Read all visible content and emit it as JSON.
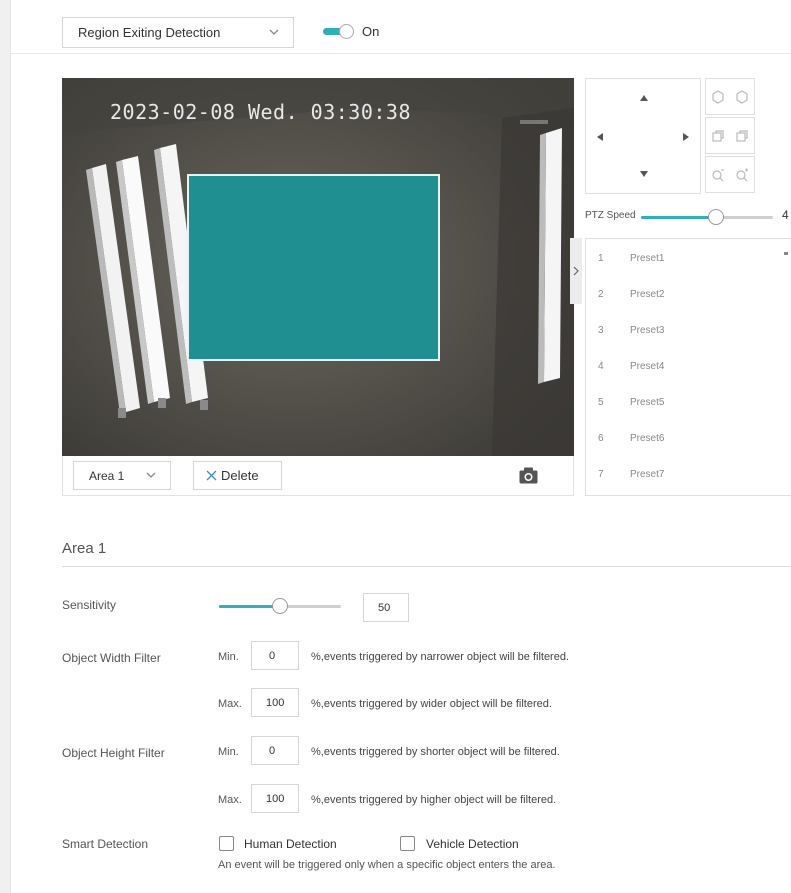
{
  "header": {
    "detection_select": "Region Exiting Detection",
    "toggle_label": "On",
    "toggle_on": true
  },
  "video": {
    "timestamp": "2023-02-08 Wed. 03:30:38"
  },
  "video_toolbar": {
    "area_select": "Area 1",
    "delete_label": "Delete"
  },
  "ptz": {
    "speed_label": "PTZ Speed",
    "speed_value": "4",
    "speed_fraction": 0.57
  },
  "presets": [
    {
      "num": "1",
      "name": "Preset1"
    },
    {
      "num": "2",
      "name": "Preset2"
    },
    {
      "num": "3",
      "name": "Preset3"
    },
    {
      "num": "4",
      "name": "Preset4"
    },
    {
      "num": "5",
      "name": "Preset5"
    },
    {
      "num": "6",
      "name": "Preset6"
    },
    {
      "num": "7",
      "name": "Preset7"
    }
  ],
  "area_section": {
    "title": "Area 1"
  },
  "sensitivity": {
    "label": "Sensitivity",
    "value": "50",
    "fraction": 0.5
  },
  "width_filter": {
    "label": "Object Width Filter",
    "min_label": "Min.",
    "min_value": "0",
    "min_hint": "%,events triggered by narrower object will be filtered.",
    "max_label": "Max.",
    "max_value": "100",
    "max_hint": "%,events triggered by wider object will be filtered."
  },
  "height_filter": {
    "label": "Object Height Filter",
    "min_label": "Min.",
    "min_value": "0",
    "min_hint": "%,events triggered by shorter object will be filtered.",
    "max_label": "Max.",
    "max_value": "100",
    "max_hint": "%,events triggered by higher object will be filtered."
  },
  "smart_detection": {
    "label": "Smart Detection",
    "human_label": "Human Detection",
    "vehicle_label": "Vehicle Detection",
    "note": "An event will be triggered only when a specific object enters the area."
  },
  "colors": {
    "accent": "#2fb0b8",
    "roi_fill": "#1f8f92"
  },
  "icons": [
    "chevron-down-icon",
    "pan-up-icon",
    "pan-down-icon",
    "pan-left-icon",
    "pan-right-icon",
    "focus-near-icon",
    "focus-far-icon",
    "iris-close-icon",
    "iris-open-icon",
    "zoom-out-icon",
    "zoom-in-icon",
    "close-icon",
    "camera-icon",
    "collapse-arrow-icon"
  ]
}
